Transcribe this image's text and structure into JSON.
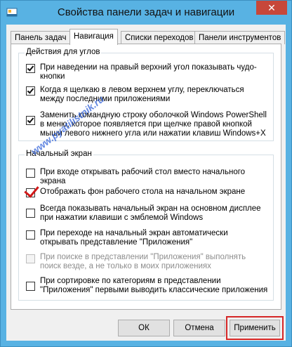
{
  "window": {
    "title": "Свойства панели задач и навигации",
    "close_label": "✕"
  },
  "tabs": [
    {
      "label": "Панель задач",
      "active": false
    },
    {
      "label": "Навигация",
      "active": true
    },
    {
      "label": "Списки переходов",
      "active": false
    },
    {
      "label": "Панели инструментов",
      "active": false
    }
  ],
  "corners_group": {
    "title": "Действия для углов",
    "options": [
      {
        "label": "При наведении на правый верхний угол показывать чудо-кнопки",
        "checked": true
      },
      {
        "label": "Когда я щелкаю в левом верхнем углу, переключаться между последними приложениями",
        "checked": true
      },
      {
        "label": "Заменить командную строку оболочкой Windows PowerShell в меню, которое появляется при щелчке правой кнопкой мыши левого нижнего угла или нажатии клавиш Windows+X",
        "checked": true
      }
    ]
  },
  "start_group": {
    "title": "Начальный экран",
    "options": [
      {
        "label": "При входе открывать рабочий стол вместо начального экрана",
        "checked": false
      },
      {
        "label": "Отображать фон рабочего стола на начальном экране",
        "checked": true
      },
      {
        "label": "Всегда показывать начальный экран на основном дисплее при нажатии клавиши с эмблемой Windows",
        "checked": false
      },
      {
        "label": "При переходе на начальный экран автоматически открывать представление \"Приложения\"",
        "checked": false
      },
      {
        "label": "При поиске в представлении \"Приложения\" выполнять поиск везде, а не только в моих приложениях",
        "checked": false,
        "disabled": true
      },
      {
        "label": "При сортировке по категориям в представлении \"Приложения\" первыми выводить классические приложения",
        "checked": false
      }
    ]
  },
  "buttons": {
    "ok": "ОК",
    "cancel": "Отмена",
    "apply": "Применить"
  },
  "watermark": "www.pyatilistnik.ru",
  "colors": {
    "title_bar": "#58b2e3",
    "close_button": "#c7473a",
    "highlight": "#d52626"
  }
}
